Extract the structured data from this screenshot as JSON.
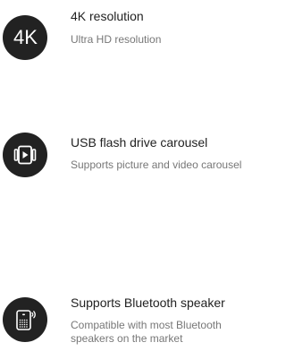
{
  "features": [
    {
      "icon": "4k-icon",
      "icon_text": "4K",
      "title": "4K resolution",
      "description": "Ultra HD resolution"
    },
    {
      "icon": "play-carousel-icon",
      "title": "USB flash drive carousel",
      "description": "Supports picture and video carousel"
    },
    {
      "icon": "bluetooth-speaker-icon",
      "title": "Supports Bluetooth speaker",
      "description": "Compatible with most Bluetooth speakers on the market"
    }
  ],
  "colors": {
    "icon_background": "#222222",
    "title": "#222222",
    "description": "#777777"
  }
}
